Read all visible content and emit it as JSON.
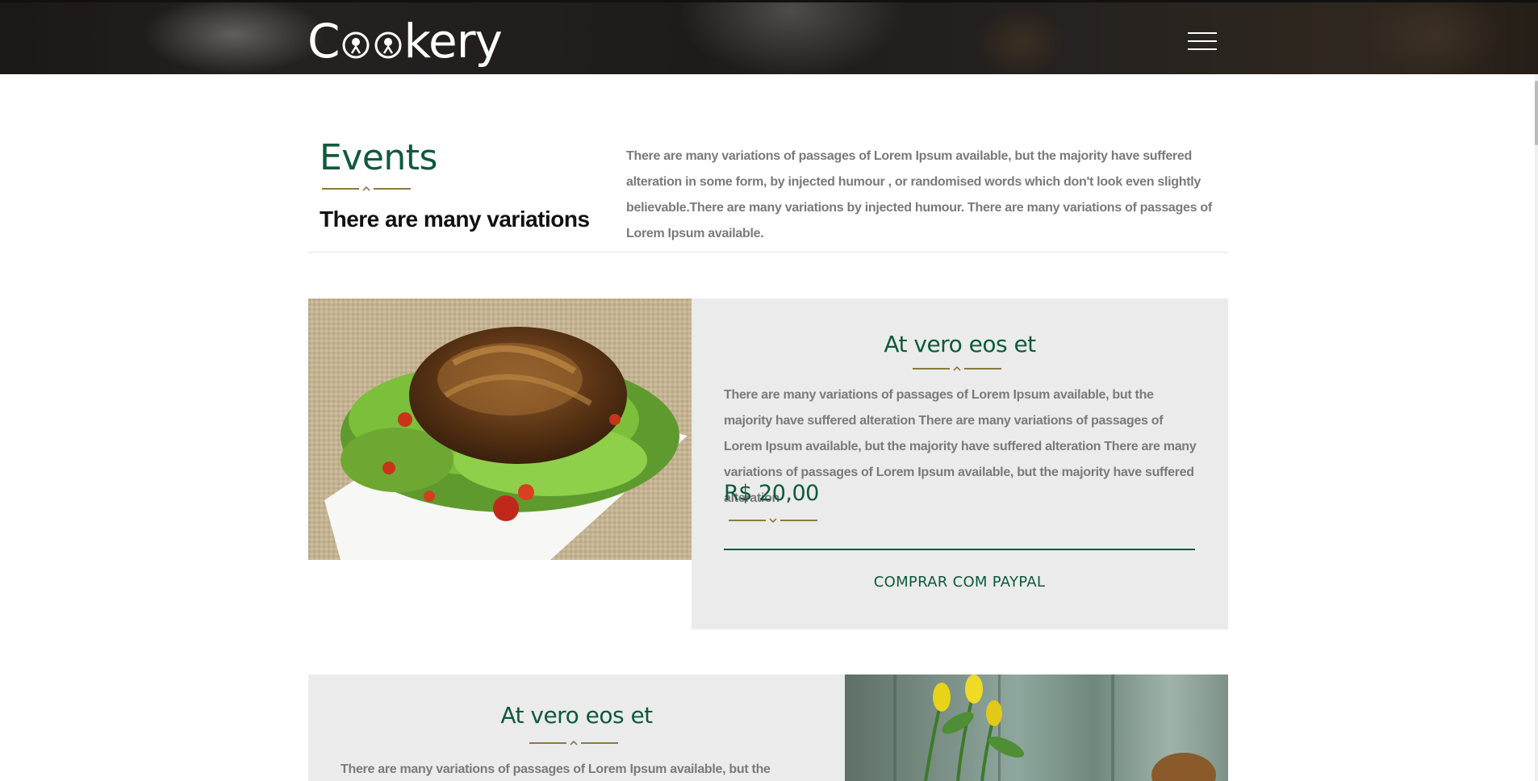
{
  "header": {
    "logo_text_start": "C",
    "logo_text_end": "kery",
    "menu_label": "Menu"
  },
  "events": {
    "title": "Events",
    "subtitle": "There are many variations",
    "description": "There are many variations of passages of Lorem Ipsum available, but the majority have suffered alteration in some form, by injected humour , or randomised words which don't look even slightly believable.There are many variations by injected humour. There are many variations of passages of Lorem Ipsum available."
  },
  "products": [
    {
      "title": "At vero eos et",
      "description": "There are many variations of passages of Lorem Ipsum available, but the majority have suffered alteration There are many variations of passages of Lorem Ipsum available, but the majority have suffered alteration There are many variations of passages of Lorem Ipsum available, but the majority have suffered alteration",
      "price": "R$ 20,00",
      "button_label": "COMPRAR COM PAYPAL",
      "image": "roast-meat-on-salad-plate"
    },
    {
      "title": "At vero eos et",
      "description": "There are many variations of passages of Lorem Ipsum available, but the majority have",
      "image": "yellow-tulips-on-wooden-background"
    }
  ],
  "colors": {
    "brand_green": "#0e5a3a",
    "divider_gold": "#8a7a3e",
    "card_bg": "#ebebeb",
    "body_text": "#7a7a7a"
  }
}
